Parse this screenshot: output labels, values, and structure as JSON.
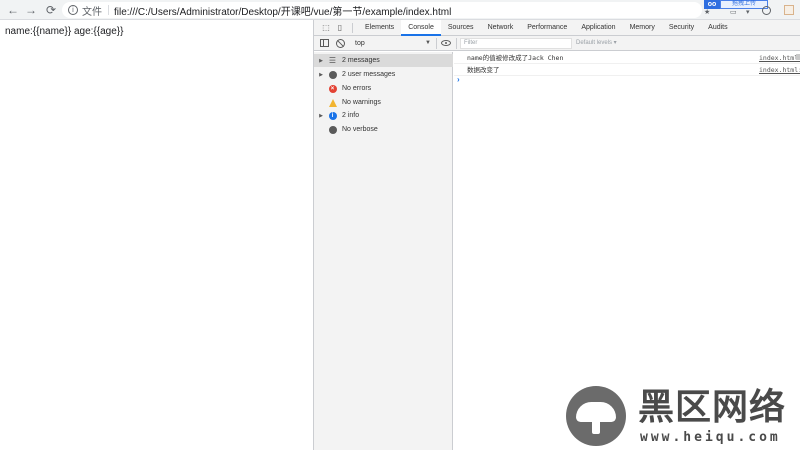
{
  "browser": {
    "back_icon": "arrow-left-icon",
    "back_glyph": "←",
    "forward_glyph": "→",
    "reload_glyph": "⟳",
    "info_glyph": "i",
    "file_label": "文件",
    "url": "file:///C:/Users/Administrator/Desktop/开课吧/vue/第一节/example/index.html",
    "extension_badge": "oo",
    "upload_label": "拖拽上传"
  },
  "page": {
    "content_text": "name:{{name}} age:{{age}}"
  },
  "devtools": {
    "tabs": [
      {
        "label": "Elements"
      },
      {
        "label": "Console"
      },
      {
        "label": "Sources"
      },
      {
        "label": "Network"
      },
      {
        "label": "Performance"
      },
      {
        "label": "Application"
      },
      {
        "label": "Memory"
      },
      {
        "label": "Security"
      },
      {
        "label": "Audits"
      }
    ],
    "active_tab": "Console",
    "toolbar": {
      "context_value": "top",
      "filter_placeholder": "Filter",
      "levels_label": "Default levels ▾"
    },
    "sidebar": {
      "items": [
        {
          "label": "2 messages",
          "icon": "list-icon",
          "selected": true
        },
        {
          "label": "2 user messages",
          "icon": "user-icon"
        },
        {
          "label": "No errors",
          "icon": "error-icon"
        },
        {
          "label": "No warnings",
          "icon": "warning-icon"
        },
        {
          "label": "2 info",
          "icon": "info-icon"
        },
        {
          "label": "No verbose",
          "icon": "gear-icon"
        }
      ]
    },
    "console": {
      "messages": [
        {
          "text": "name的值被修改成了Jack Chen",
          "source": "index.html:"
        },
        {
          "text": "数据改变了",
          "source": "index.html:"
        }
      ],
      "prompt": "›"
    }
  },
  "watermark": {
    "title": "黑区网络",
    "url": "www.heiqu.com"
  }
}
